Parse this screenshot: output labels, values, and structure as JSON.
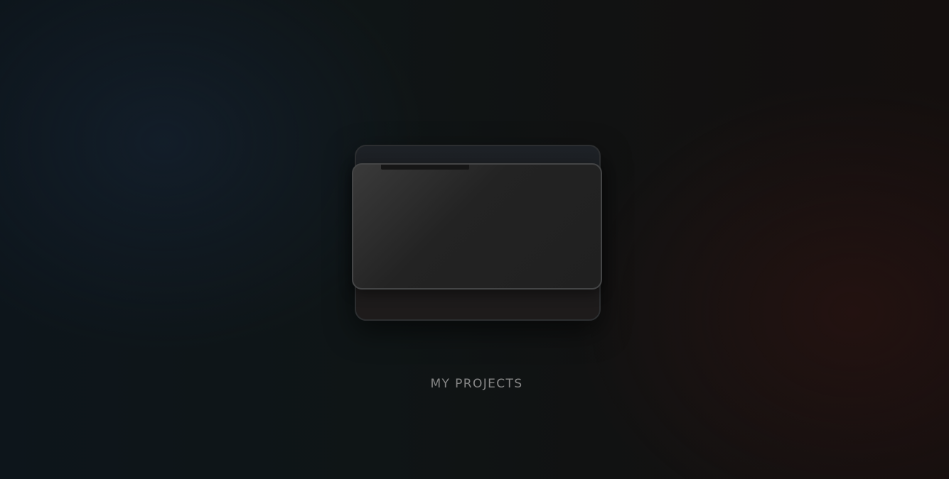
{
  "folder": {
    "label": "MY PROJECTS",
    "icon": "folder-icon"
  },
  "colors": {
    "background_left": "#0d151b",
    "background_right": "#140f0e",
    "folder_front": "#232323",
    "folder_back": "#1b1b1c",
    "label_text": "#878787"
  }
}
